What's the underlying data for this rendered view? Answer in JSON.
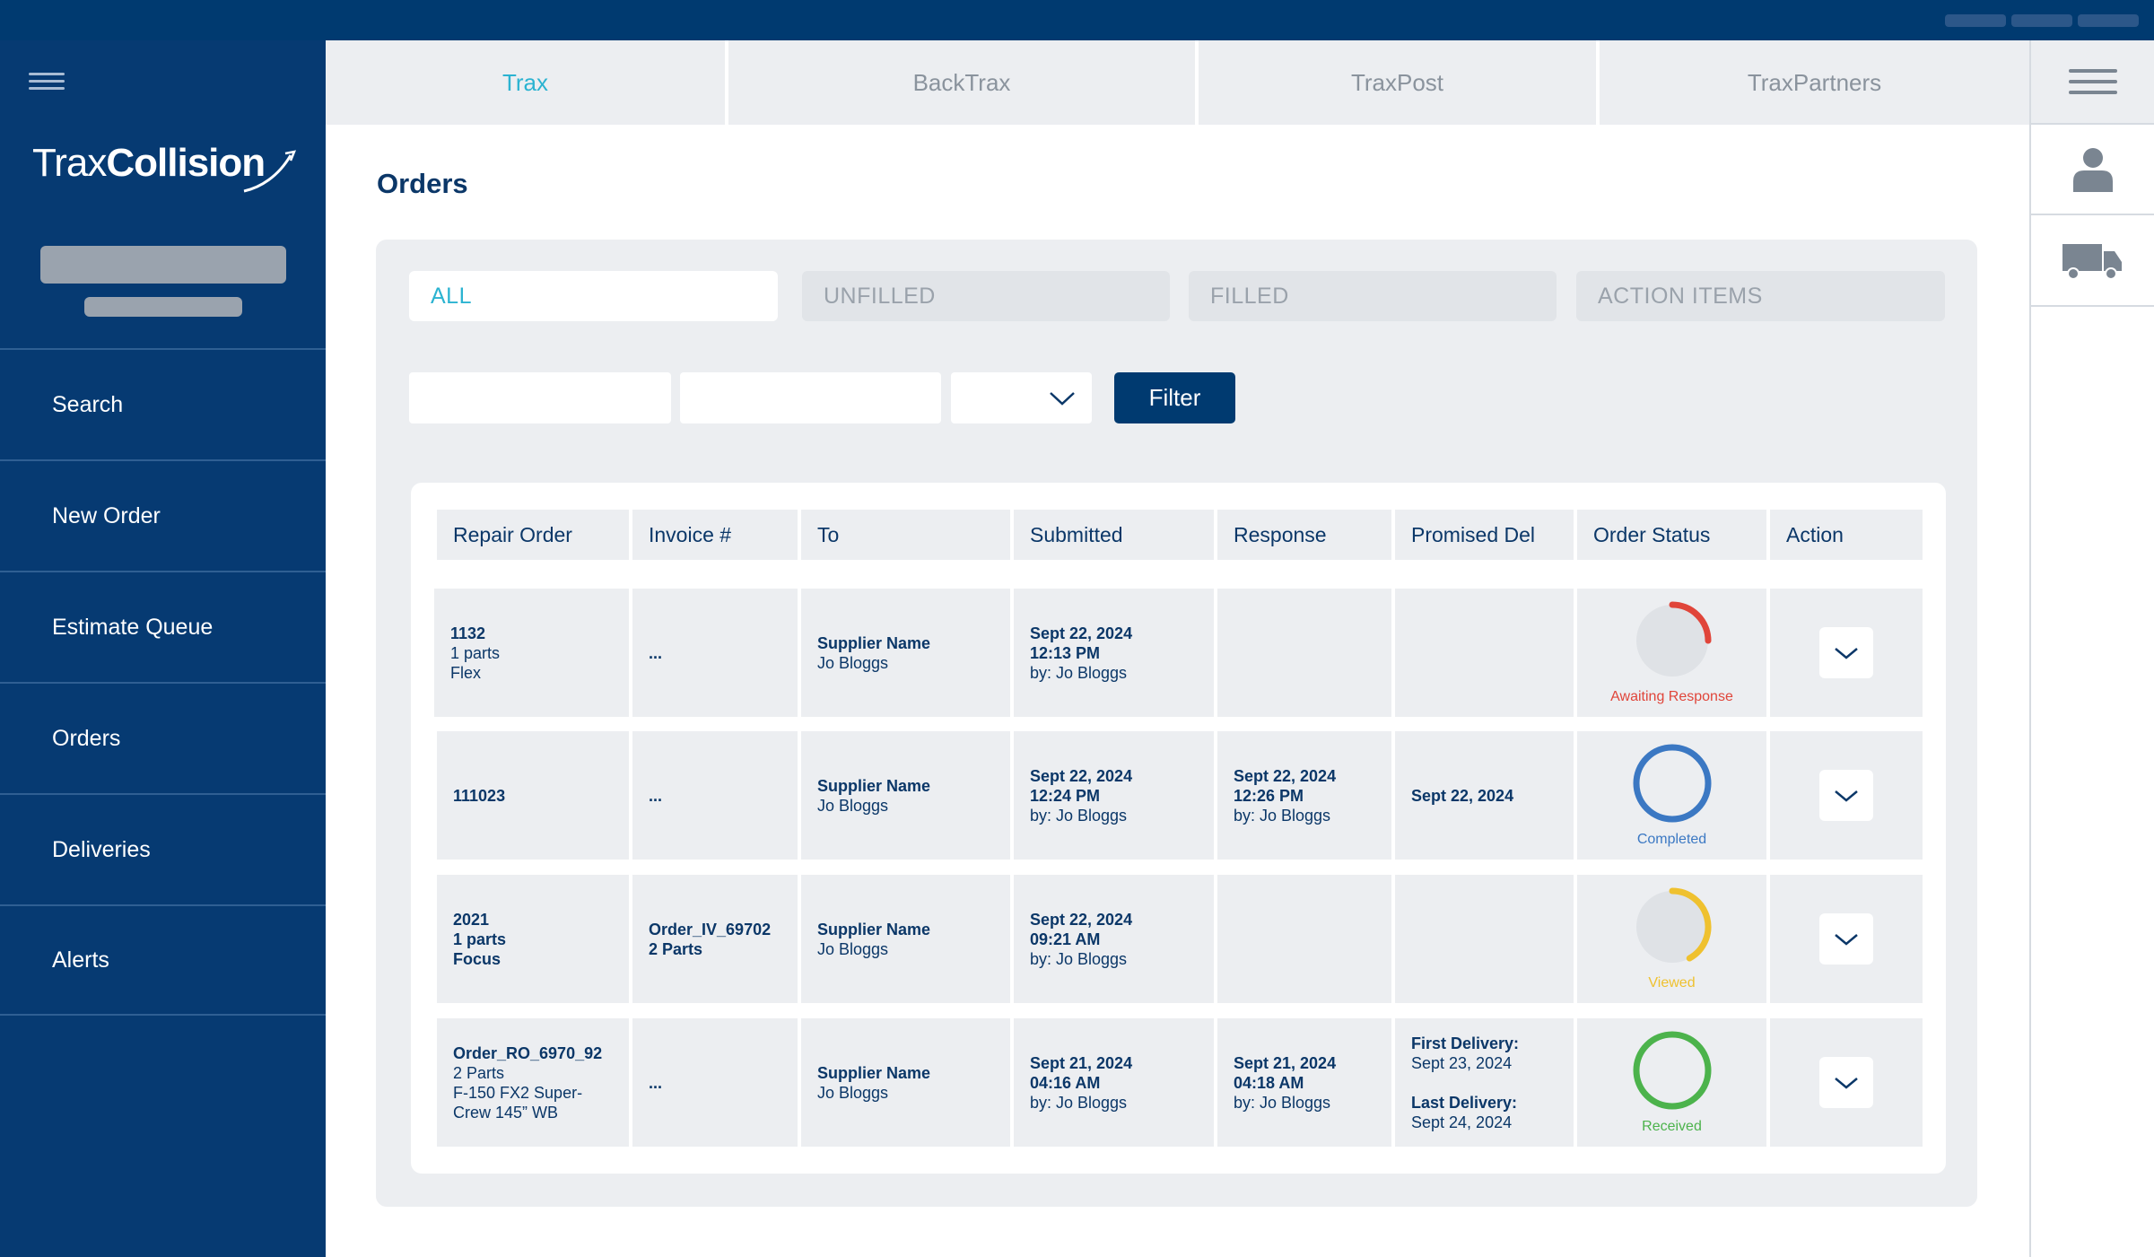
{
  "app": {
    "logo_part1": "Trax",
    "logo_part2": "Collision"
  },
  "sidebar": {
    "items": [
      {
        "label": "Search"
      },
      {
        "label": "New Order"
      },
      {
        "label": "Estimate Queue"
      },
      {
        "label": "Orders"
      },
      {
        "label": "Deliveries"
      },
      {
        "label": "Alerts"
      }
    ]
  },
  "tabs": [
    {
      "label": "Trax",
      "active": true
    },
    {
      "label": "BackTrax",
      "active": false
    },
    {
      "label": "TraxPost",
      "active": false
    },
    {
      "label": "TraxPartners",
      "active": false
    }
  ],
  "rail": {
    "icons": [
      "menu-icon",
      "user-icon",
      "truck-icon"
    ]
  },
  "page": {
    "title": "Orders"
  },
  "filters": {
    "tabs": [
      {
        "label": "ALL",
        "active": true
      },
      {
        "label": "UNFILLED",
        "active": false
      },
      {
        "label": "FILLED",
        "active": false
      },
      {
        "label": "ACTION ITEMS",
        "active": false
      }
    ],
    "input1_value": "",
    "input2_value": "",
    "select_value": "",
    "button_label": "Filter"
  },
  "table": {
    "headers": [
      "Repair Order",
      "Invoice #",
      "To",
      "Submitted",
      "Response",
      "Promised Del",
      "Order Status",
      "Action"
    ],
    "rows": [
      {
        "repair_order": {
          "line1": "1132",
          "line2": "1 parts",
          "line3": "Flex",
          "bold_all": false
        },
        "invoice": {
          "line1": "...",
          "line2": ""
        },
        "to": {
          "name": "Supplier Name",
          "contact": "Jo Bloggs"
        },
        "submitted": {
          "date": "Sept 22, 2024",
          "time": "12:13 PM",
          "by": "by: Jo Bloggs"
        },
        "response": {
          "date": "",
          "time": "",
          "by": ""
        },
        "promised": {
          "text": ""
        },
        "status": {
          "label": "Awaiting Response",
          "progress": 0.25,
          "color": "#e0453a"
        }
      },
      {
        "repair_order": {
          "line1": "111023",
          "line2": "",
          "line3": "",
          "bold_all": false
        },
        "invoice": {
          "line1": "...",
          "line2": ""
        },
        "to": {
          "name": "Supplier Name",
          "contact": "Jo Bloggs"
        },
        "submitted": {
          "date": "Sept 22, 2024",
          "time": "12:24 PM",
          "by": "by: Jo Bloggs"
        },
        "response": {
          "date": "Sept 22, 2024",
          "time": "12:26 PM",
          "by": "by: Jo Bloggs"
        },
        "promised": {
          "text": "Sept 22, 2024"
        },
        "status": {
          "label": "Completed",
          "progress": 1.0,
          "color": "#3b78c3"
        }
      },
      {
        "repair_order": {
          "line1": "2021",
          "line2": "1 parts",
          "line3": "Focus",
          "bold_all": true
        },
        "invoice": {
          "line1": "Order_IV_69702",
          "line2": "2 Parts"
        },
        "to": {
          "name": "Supplier Name",
          "contact": "Jo Bloggs"
        },
        "submitted": {
          "date": "Sept 22, 2024",
          "time": "09:21 AM",
          "by": "by: Jo Bloggs"
        },
        "response": {
          "date": "",
          "time": "",
          "by": ""
        },
        "promised": {
          "text": ""
        },
        "status": {
          "label": "Viewed",
          "progress": 0.42,
          "color": "#efc12f"
        }
      },
      {
        "repair_order": {
          "line1": "Order_RO_6970_92",
          "line2": "2 Parts",
          "line3": "F-150 FX2 Super-",
          "line4": "Crew 145” WB",
          "bold_all": false
        },
        "invoice": {
          "line1": "...",
          "line2": ""
        },
        "to": {
          "name": "Supplier Name",
          "contact": "Jo Bloggs"
        },
        "submitted": {
          "date": "Sept 21, 2024",
          "time": "04:16 AM",
          "by": "by: Jo Bloggs"
        },
        "response": {
          "date": "Sept 21, 2024",
          "time": "04:18 AM",
          "by": "by: Jo Bloggs"
        },
        "promised": {
          "first_label": "First Delivery:",
          "first_date": "Sept 23, 2024",
          "last_label": "Last Delivery:",
          "last_date": "Sept 24, 2024"
        },
        "status": {
          "label": "Received",
          "progress": 1.0,
          "color": "#4cb34c"
        }
      }
    ]
  }
}
